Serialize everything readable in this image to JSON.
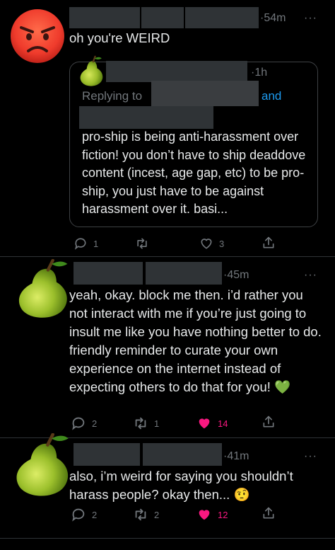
{
  "tweet1": {
    "timestamp": "54m",
    "text": "oh you're WEIRD",
    "more": "···",
    "avatar_icon": "angry-face-icon",
    "quote": {
      "timestamp": "1h",
      "replying_prefix": "Replying to",
      "and_text": "and",
      "text": "pro-ship is being anti-harassment over fiction! you don’t have to ship deaddove content (incest, age gap, etc) to be pro-ship, you just have to be against harassment over it. basi...",
      "avatar_icon": "pear-icon"
    },
    "actions": {
      "replies": "1",
      "retweets": "",
      "likes": "3"
    }
  },
  "tweet2": {
    "timestamp": "45m",
    "text": "yeah, okay. block me then. i’d rather you not interact with me if you’re just going to insult me like you have nothing better to do. friendly reminder to curate your own experience on the internet instead of expecting others to do that for you!",
    "emoji": "💚",
    "more": "···",
    "avatar_icon": "pear-icon",
    "actions": {
      "replies": "2",
      "retweets": "1",
      "likes": "14"
    }
  },
  "tweet3": {
    "timestamp": "41m",
    "text": "also, i’m weird for saying you shouldn’t harass people? okay then...",
    "emoji": "🤨",
    "more": "···",
    "avatar_icon": "pear-icon",
    "actions": {
      "replies": "2",
      "retweets": "2",
      "likes": "12"
    }
  },
  "colors": {
    "background": "#000000",
    "text": "#e7e9ea",
    "muted": "#71767b",
    "link": "#1d9bf0",
    "like": "#f91880"
  }
}
